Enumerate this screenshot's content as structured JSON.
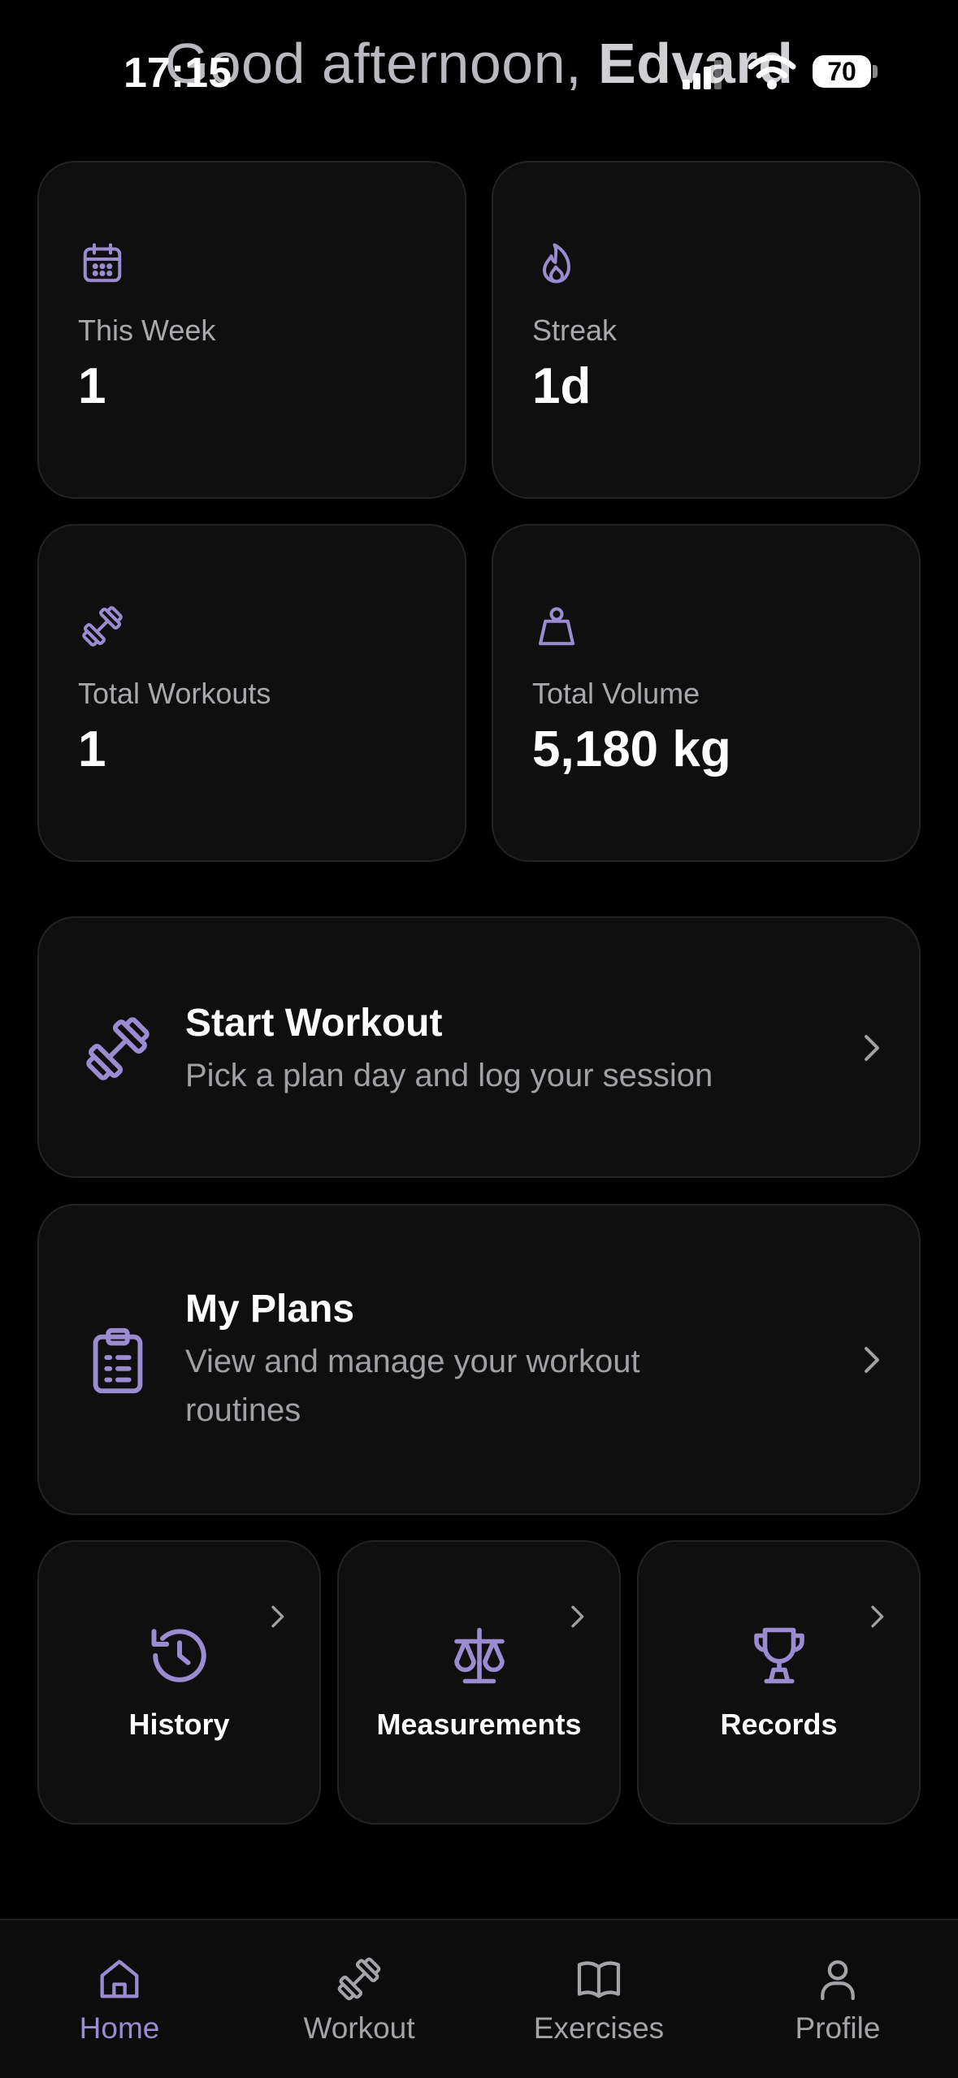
{
  "status_bar": {
    "time": "17:15",
    "battery": "70"
  },
  "header": {
    "greeting_prefix": "Good afternoon, ",
    "greeting_name": "Edvard"
  },
  "stats": [
    {
      "icon": "calendar-icon",
      "label": "This Week",
      "value": "1"
    },
    {
      "icon": "flame-icon",
      "label": "Streak",
      "value": "1d"
    },
    {
      "icon": "dumbbell-icon",
      "label": "Total Workouts",
      "value": "1"
    },
    {
      "icon": "weight-icon",
      "label": "Total Volume",
      "value": "5,180 kg"
    }
  ],
  "actions": {
    "start_workout": {
      "title": "Start Workout",
      "subtitle": "Pick a plan day and log your session"
    },
    "my_plans": {
      "title": "My Plans",
      "subtitle": "View and manage your workout routines"
    }
  },
  "tiles": [
    {
      "icon": "history-icon",
      "label": "History"
    },
    {
      "icon": "scale-icon",
      "label": "Measurements"
    },
    {
      "icon": "trophy-icon",
      "label": "Records"
    }
  ],
  "tabs": [
    {
      "icon": "home-icon",
      "label": "Home",
      "active": true
    },
    {
      "icon": "dumbbell-icon",
      "label": "Workout"
    },
    {
      "icon": "book-icon",
      "label": "Exercises"
    },
    {
      "icon": "user-icon",
      "label": "Profile"
    }
  ],
  "colors": {
    "accent": "#9b8bd0",
    "card": "#0f0f10",
    "background": "#000000"
  }
}
